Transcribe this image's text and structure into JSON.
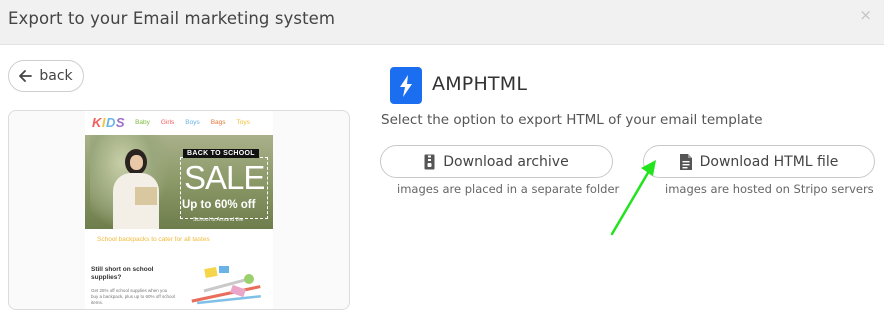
{
  "header": {
    "title": "Export to your Email marketing system",
    "close_label": "×"
  },
  "back": {
    "label": "back"
  },
  "preview": {
    "logo": [
      "K",
      "I",
      "D",
      "S"
    ],
    "nav": [
      "Baby",
      "Girls",
      "Boys",
      "Bags",
      "Toys"
    ],
    "nav_colors": [
      "#7dbb3e",
      "#f25c5c",
      "#69b4e8",
      "#e5793b",
      "#f0c03a"
    ],
    "banner": {
      "tag": "BACK TO SCHOOL",
      "headline": "SALE",
      "offer": "Up to 60% off",
      "caption": "School is Around the"
    },
    "promo": "School backpacks to cater for all tastes",
    "section_title": "Still short on school supplies?",
    "section_text": "Get 25% off school supplies when you buy a backpack, plus up to 60% off school items."
  },
  "platform": {
    "name": "AMPHTML",
    "accent": "#1a6eef"
  },
  "instruction": "Select the option to export HTML of your email template",
  "options": [
    {
      "label": "Download archive",
      "icon": "zip-file-icon",
      "note": "images are placed in a separate folder"
    },
    {
      "label": "Download HTML file",
      "icon": "document-icon",
      "note": "images are hosted on Stripo servers"
    }
  ],
  "annotation_color": "#21e41c"
}
